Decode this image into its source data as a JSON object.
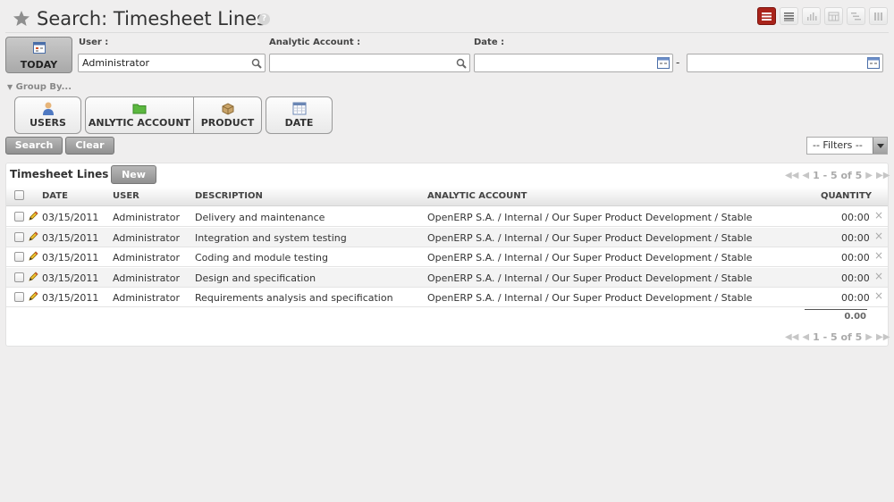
{
  "header": {
    "title": "Search: Timesheet Lines",
    "help": "?",
    "views": [
      {
        "name": "list-view",
        "active": true
      },
      {
        "name": "page-view",
        "active": false
      },
      {
        "name": "graph-view",
        "active": false
      },
      {
        "name": "calendar-view",
        "active": false
      },
      {
        "name": "gantt-view",
        "active": false
      },
      {
        "name": "kanban-view",
        "active": false
      }
    ]
  },
  "search": {
    "today_label": "TODAY",
    "user_label": "User :",
    "user_value": "Administrator",
    "analytic_label": "Analytic Account :",
    "analytic_value": "",
    "date_label": "Date :",
    "date_from": "",
    "date_sep": "-",
    "date_to": "",
    "group_by_label": "Group By...",
    "group_by": [
      "USERS",
      "ANLYTIC ACCOUNT",
      "PRODUCT",
      "DATE"
    ],
    "search_btn": "Search",
    "clear_btn": "Clear",
    "filters": "-- Filters --"
  },
  "list": {
    "title": "Timesheet Lines",
    "new_btn": "New",
    "pager_top": "1 - 5 of 5",
    "pager_bottom": "1 - 5 of 5",
    "columns": [
      "DATE",
      "USER",
      "DESCRIPTION",
      "ANALYTIC ACCOUNT",
      "QUANTITY"
    ],
    "rows": [
      {
        "date": "03/15/2011",
        "user": "Administrator",
        "description": "Delivery and maintenance",
        "account": "OpenERP S.A. / Internal / Our Super Product Development / Stable",
        "quantity": "00:00"
      },
      {
        "date": "03/15/2011",
        "user": "Administrator",
        "description": "Integration and system testing",
        "account": "OpenERP S.A. / Internal / Our Super Product Development / Stable",
        "quantity": "00:00"
      },
      {
        "date": "03/15/2011",
        "user": "Administrator",
        "description": "Coding and module testing",
        "account": "OpenERP S.A. / Internal / Our Super Product Development / Stable",
        "quantity": "00:00"
      },
      {
        "date": "03/15/2011",
        "user": "Administrator",
        "description": "Design and specification",
        "account": "OpenERP S.A. / Internal / Our Super Product Development / Stable",
        "quantity": "00:00"
      },
      {
        "date": "03/15/2011",
        "user": "Administrator",
        "description": "Requirements analysis and specification",
        "account": "OpenERP S.A. / Internal / Our Super Product Development / Stable",
        "quantity": "00:00"
      }
    ],
    "total": "0.00"
  },
  "colors": {
    "accent": "#a9231a",
    "background": "#efeeee"
  }
}
